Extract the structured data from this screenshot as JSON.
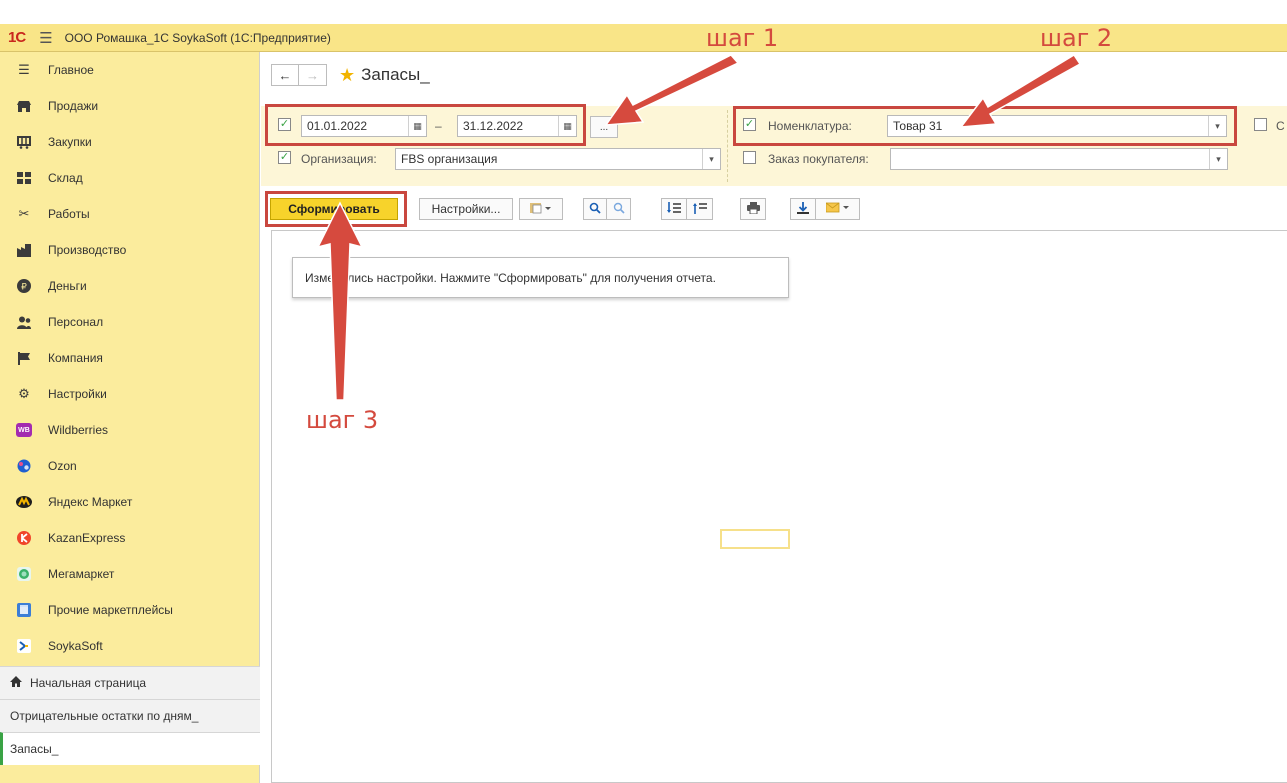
{
  "app": {
    "logo": "1С",
    "title": "ООО Ромашка_1С SoykaSoft  (1С:Предприятие)"
  },
  "sidebar": {
    "items": [
      {
        "label": "Главное",
        "icon": "menu-lines-icon"
      },
      {
        "label": "Продажи",
        "icon": "shop-icon"
      },
      {
        "label": "Закупки",
        "icon": "cart-icon"
      },
      {
        "label": "Склад",
        "icon": "warehouse-icon"
      },
      {
        "label": "Работы",
        "icon": "tools-icon"
      },
      {
        "label": "Производство",
        "icon": "factory-icon"
      },
      {
        "label": "Деньги",
        "icon": "ruble-icon"
      },
      {
        "label": "Персонал",
        "icon": "people-icon"
      },
      {
        "label": "Компания",
        "icon": "flag-icon"
      },
      {
        "label": "Настройки",
        "icon": "gear-icon"
      },
      {
        "label": "Wildberries",
        "icon": "wildberries-icon",
        "badge": "WB",
        "color": "#a32bb0"
      },
      {
        "label": "Ozon",
        "icon": "ozon-icon",
        "color": "#1f5fd1"
      },
      {
        "label": "Яндекс Маркет",
        "icon": "yandex-market-icon",
        "color": "#f2b400"
      },
      {
        "label": "KazanExpress",
        "icon": "kazanexpress-icon",
        "color": "#f0452a"
      },
      {
        "label": "Мегамаркет",
        "icon": "megamarket-icon",
        "color": "#3bb26a"
      },
      {
        "label": "Прочие маркетплейсы",
        "icon": "other-marketplaces-icon",
        "color": "#3c7ed6"
      },
      {
        "label": "SoykaSoft",
        "icon": "soykasoft-icon",
        "color": "#1a5fb4"
      }
    ]
  },
  "open_windows": [
    {
      "label": "Начальная страница",
      "icon": "home-icon",
      "active": false
    },
    {
      "label": "Отрицательные остатки по дням_",
      "active": false
    },
    {
      "label": "Запасы_",
      "active": true
    }
  ],
  "page": {
    "title": "Запасы_"
  },
  "filters": {
    "period": {
      "checked": true,
      "from": "01.01.2022",
      "dash": "–",
      "to": "31.12.2022",
      "more": "..."
    },
    "organization": {
      "checked": true,
      "label": "Организация:",
      "value": "FBS организация"
    },
    "nomenclature": {
      "checked": true,
      "label": "Номенклатура:",
      "value": "Товар 31"
    },
    "customer_order": {
      "checked": false,
      "label": "Заказ покупателя:",
      "value": ""
    },
    "extra": {
      "checked": false,
      "label": "С"
    }
  },
  "toolbar": {
    "generate_label": "Сформировать",
    "settings_label": "Настройки..."
  },
  "report": {
    "message": "Изменились настройки. Нажмите \"Сформировать\" для получения отчета."
  },
  "annotations": {
    "step1": "шаг 1",
    "step2": "шаг 2",
    "step3": "шаг 3"
  },
  "colors": {
    "accent_yellow": "#f7d32b",
    "sidebar_bg": "#fbec9d",
    "annotation_red": "#c9473f",
    "check_green": "#3aa345"
  }
}
